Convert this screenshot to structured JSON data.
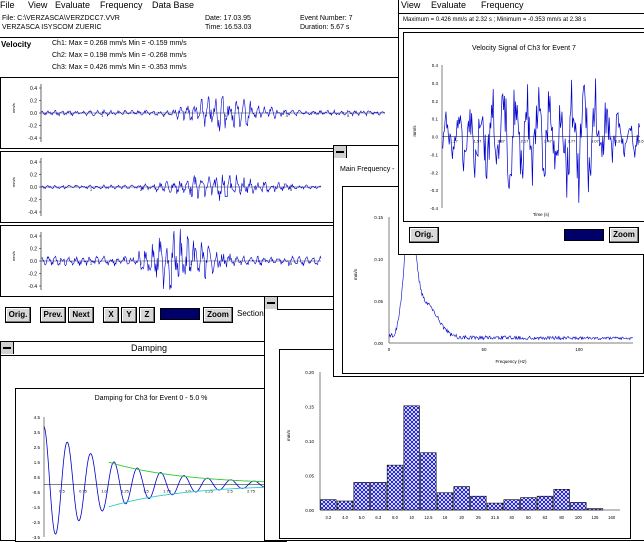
{
  "menubar": {
    "items": [
      "File",
      "View",
      "Evaluate",
      "Frequency",
      "Data Base"
    ]
  },
  "header": {
    "file": "File: C:\\VERZASCA\\VERZDCC7.VVR",
    "station": "VERZASCA    ISYSCOM  ZUERIC",
    "date": "Date: 17.03.95",
    "time": "Time: 16.53.03",
    "event": "Event Number: 7",
    "duration": "Duration: 5.67 s"
  },
  "velocity": {
    "label": "Velocity",
    "ch1": "Ch1:  Max = 0.268 mm/s   Min = -0.159 mm/s",
    "ch2": "Ch2:  Max = 0.198 mm/s   Min = -0.268 mm/s",
    "ch3": "Ch3:  Max = 0.426 mm/s   Min = -0.353 mm/s",
    "unit": "mm/s",
    "yticks": [
      "0.4",
      "0.2",
      "0.0",
      "-0.2",
      "-0.4"
    ],
    "xticks": [
      "1",
      "2",
      "3",
      "4",
      "5"
    ],
    "color": "#0000cc"
  },
  "toolbar": {
    "orig": "Orig.",
    "prev": "Prev.",
    "next": "Next",
    "x": "X",
    "y": "Y",
    "z": "Z",
    "zoom": "Zoom",
    "section": "Section"
  },
  "signal_window": {
    "menu": [
      "View",
      "Evaluate",
      "Frequency"
    ],
    "info": "Maximum = 0.426 mm/s at 2.32 s ; Minimum = -0.353 mm/s at 2.38 s",
    "title": "Velocity Signal of Ch3 for Event 7",
    "ylabel": "mm/s",
    "xlabel": "Time (s)",
    "yticks": [
      "0.4",
      "0.3",
      "0.2",
      "0.1",
      "0.0",
      "-0.1",
      "-0.2",
      "-0.3",
      "-0.4"
    ],
    "xticks": [
      "1.27",
      "1.57",
      "1.87",
      "2.17",
      "2.47",
      "2.77",
      "3.07",
      "3.37",
      "3.67"
    ],
    "orig": "Orig.",
    "zoom": "Zoom"
  },
  "freq_window": {
    "title": "Main Frequency -",
    "ylabel": "mm/s",
    "xlabel": "Frequency (Hz)",
    "yticks": [
      "0.15",
      "0.10",
      "0.05",
      "0.00"
    ],
    "xticks": [
      "0",
      "50",
      "100"
    ]
  },
  "damping_window": {
    "title": "Damping",
    "chart_title": "Damping for Ch3 for Event 0 - 5.0 %",
    "yticks": [
      "4.5",
      "3.5",
      "2.5",
      "1.5",
      "0.5",
      "-0.5",
      "-1.5",
      "-2.5",
      "-3.5"
    ],
    "xticks": [
      "0.5",
      "0.75",
      "1.0",
      "1.25",
      "1.5",
      "1.75",
      "2.0",
      "2.25",
      "2.5",
      "2.75",
      "3.0"
    ]
  },
  "chart_data": {
    "type": "bar",
    "title": "",
    "ylabel": "mm/s",
    "categories": [
      "3.2",
      "4.0",
      "5.0",
      "6.3",
      "8.0",
      "10",
      "12.5",
      "16",
      "20",
      "25",
      "31.5",
      "40",
      "50",
      "63",
      "80",
      "100",
      "125",
      "160"
    ],
    "values": [
      0.015,
      0.013,
      0.04,
      0.04,
      0.065,
      0.151,
      0.083,
      0.025,
      0.034,
      0.02,
      0.01,
      0.015,
      0.018,
      0.02,
      0.03,
      0.011,
      0.002,
      0.0
    ],
    "ylim": [
      0,
      0.2
    ],
    "yticks": [
      "0.20",
      "0.15",
      "0.10",
      "0.05",
      "0.00"
    ],
    "bar_pattern": "blue-crosshatch"
  }
}
